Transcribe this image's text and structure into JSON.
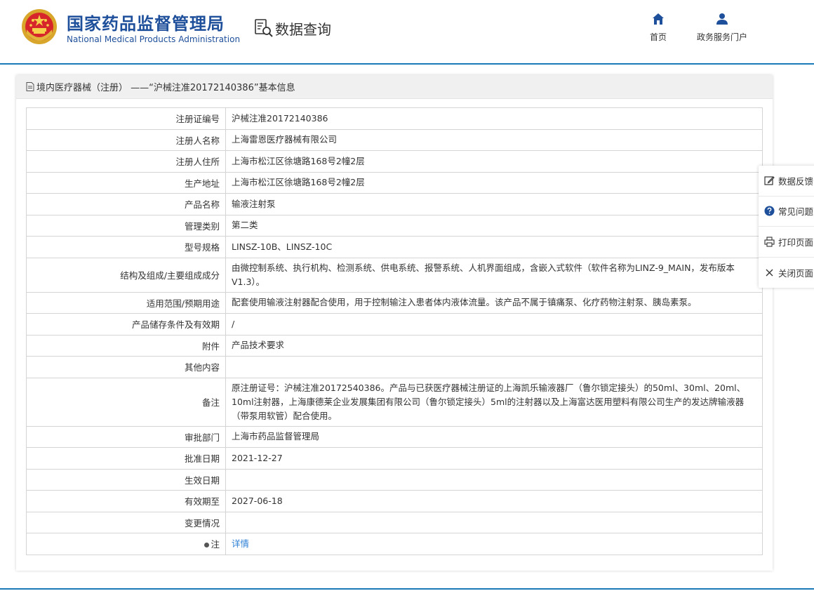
{
  "header": {
    "org_name_cn": "国家药品监督管理局",
    "org_name_en": "National Medical Products Administration",
    "query_label": "数据查询",
    "nav": [
      {
        "label": "首页",
        "icon": "home-icon"
      },
      {
        "label": "政务服务门户",
        "icon": "user-icon"
      }
    ]
  },
  "panel": {
    "title": "境内医疗器械（注册） ——“沪械注准20172140386”基本信息"
  },
  "rows": [
    {
      "label": "注册证编号",
      "value": "沪械注准20172140386"
    },
    {
      "label": "注册人名称",
      "value": "上海雷恩医疗器械有限公司"
    },
    {
      "label": "注册人住所",
      "value": "上海市松江区徐塘路168号2幢2层"
    },
    {
      "label": "生产地址",
      "value": "上海市松江区徐塘路168号2幢2层"
    },
    {
      "label": "产品名称",
      "value": "输液注射泵"
    },
    {
      "label": "管理类别",
      "value": "第二类"
    },
    {
      "label": "型号规格",
      "value": "LINSZ-10B、LINSZ-10C"
    },
    {
      "label": "结构及组成/主要组成成分",
      "value": "由微控制系统、执行机构、检测系统、供电系统、报警系统、人机界面组成，含嵌入式软件（软件名称为LINZ-9_MAIN，发布版本 V1.3）。"
    },
    {
      "label": "适用范围/预期用途",
      "value": "配套使用输液注射器配合使用，用于控制输注入患者体内液体流量。该产品不属于镇痛泵、化疗药物注射泵、胰岛素泵。"
    },
    {
      "label": "产品储存条件及有效期",
      "value": "/"
    },
    {
      "label": "附件",
      "value": "产品技术要求"
    },
    {
      "label": "其他内容",
      "value": ""
    },
    {
      "label": "备注",
      "value": "原注册证号：沪械注准20172540386。产品与已获医疗器械注册证的上海凯乐输液器厂（鲁尔锁定接头）的50ml、30ml、20ml、10ml注射器，上海康德莱企业发展集团有限公司（鲁尔锁定接头）5ml的注射器以及上海富达医用塑料有限公司生产的发达牌输液器（带泵用软管）配合使用。"
    },
    {
      "label": "审批部门",
      "value": "上海市药品监督管理局"
    },
    {
      "label": "批准日期",
      "value": "2021-12-27"
    },
    {
      "label": "生效日期",
      "value": ""
    },
    {
      "label": "有效期至",
      "value": "2027-06-18"
    },
    {
      "label": "变更情况",
      "value": ""
    },
    {
      "label": "注",
      "value": "详情"
    }
  ],
  "float_bar": [
    {
      "label": "数据反馈",
      "icon": "edit-icon"
    },
    {
      "label": "常见问题",
      "icon": "question-icon"
    },
    {
      "label": "打印页面",
      "icon": "printer-icon"
    },
    {
      "label": "关闭页面",
      "icon": "close-icon"
    }
  ],
  "colors": {
    "brand": "#1e4f9a",
    "accent_line": "#1a7ab8",
    "link": "#2b7fd4"
  }
}
